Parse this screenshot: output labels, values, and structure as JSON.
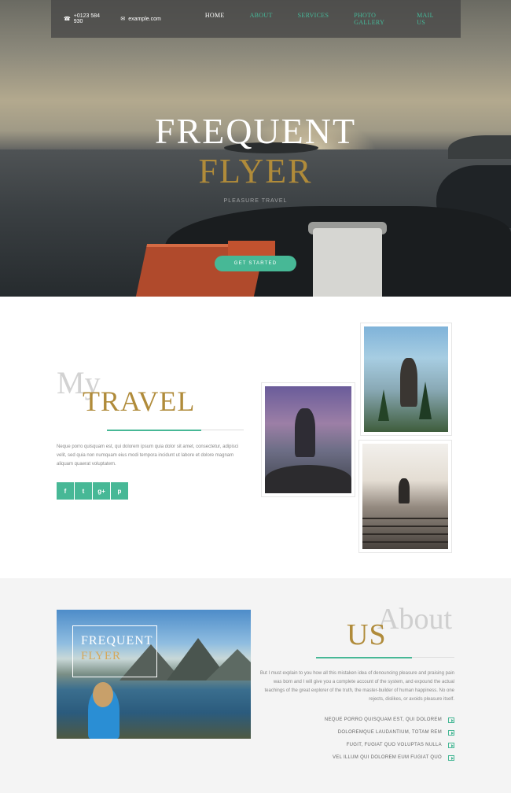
{
  "header": {
    "phone": "+0123 584 930",
    "email": "example.com",
    "nav": [
      "HOME",
      "ABOUT",
      "SERVICES",
      "PHOTO GALLERY",
      "MAIL US"
    ]
  },
  "hero": {
    "title_line1": "FREQUENT",
    "title_line2": "FLYER",
    "subtitle": "PLEASURE TRAVEL",
    "cta_label": "GET STARTED"
  },
  "travel": {
    "small_word": "My",
    "title": "TRAVEL",
    "body": "Neque porro quisquam est, qui dolorem ipsum quia dolor sit amet, consectetur, adipisci velit, sed quia non numquam eius modi tempora incidunt ut labore et dolore magnam aliquam quaerat voluptatem.",
    "social": [
      "f",
      "t",
      "g+",
      "p"
    ]
  },
  "about": {
    "image_title1": "FREQUENT",
    "image_title2": "FLYER",
    "small_word": "About",
    "title": "US",
    "body": "But I must explain to you how all this mistaken idea of denouncing pleasure and praising pain was born and I will give you a complete account of the system, and expound the actual teachings of the great explorer of the truth, the master-builder of human happiness. No one rejects, dislikes, or avoids pleasure itself.",
    "list": [
      "NEQUE PORRO QUISQUAM EST, QUI DOLOREM",
      "DOLOREMQUE LAUDANTIUM, TOTAM REM",
      "FUGIT, FUGIAT QUO VOLUPTAS NULLA",
      "VEL ILLUM QUI DOLOREM EUM FUGIAT QUO"
    ]
  },
  "colors": {
    "accent": "#47b896",
    "gold": "#b08b3a"
  }
}
